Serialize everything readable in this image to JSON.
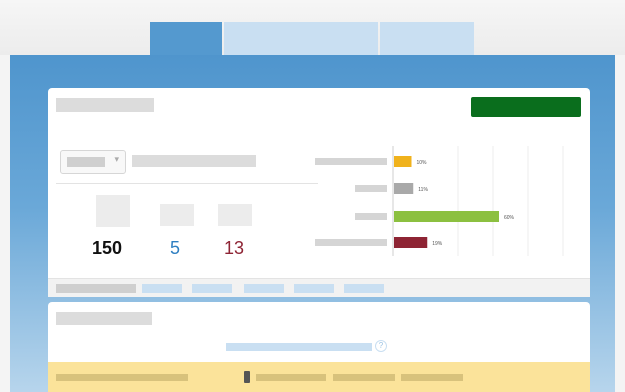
{
  "tabs": [
    {
      "label": "",
      "active": true
    },
    {
      "label": "",
      "active": false
    },
    {
      "label": "",
      "active": false
    }
  ],
  "summary_card": {
    "title": "",
    "primary_button_label": "",
    "filter_selected": "",
    "filter_caption": "",
    "stats": [
      {
        "value": "150",
        "color": "#111111"
      },
      {
        "value": "5",
        "color": "#2f7fc1"
      },
      {
        "value": "13",
        "color": "#8e2434"
      }
    ]
  },
  "chart_data": {
    "type": "bar",
    "orientation": "horizontal",
    "categories": [
      "",
      "",
      "",
      ""
    ],
    "values": [
      10,
      11,
      60,
      19
    ],
    "data_labels": [
      "10%",
      "11%",
      "60%",
      "19%"
    ],
    "colors": [
      "#f0b21c",
      "#a9a9a9",
      "#8cc040",
      "#8e2434"
    ],
    "xlim": [
      0,
      100
    ],
    "grid": true
  },
  "colors": {
    "active_tab": "#5499cf",
    "inactive_tab": "#c9dff2",
    "primary_button": "#0a6e1d",
    "warning_strip": "#fbe39a"
  },
  "detail_card": {
    "title": "",
    "help_icon": "question-circle-icon",
    "device_icon": "phone-icon"
  }
}
